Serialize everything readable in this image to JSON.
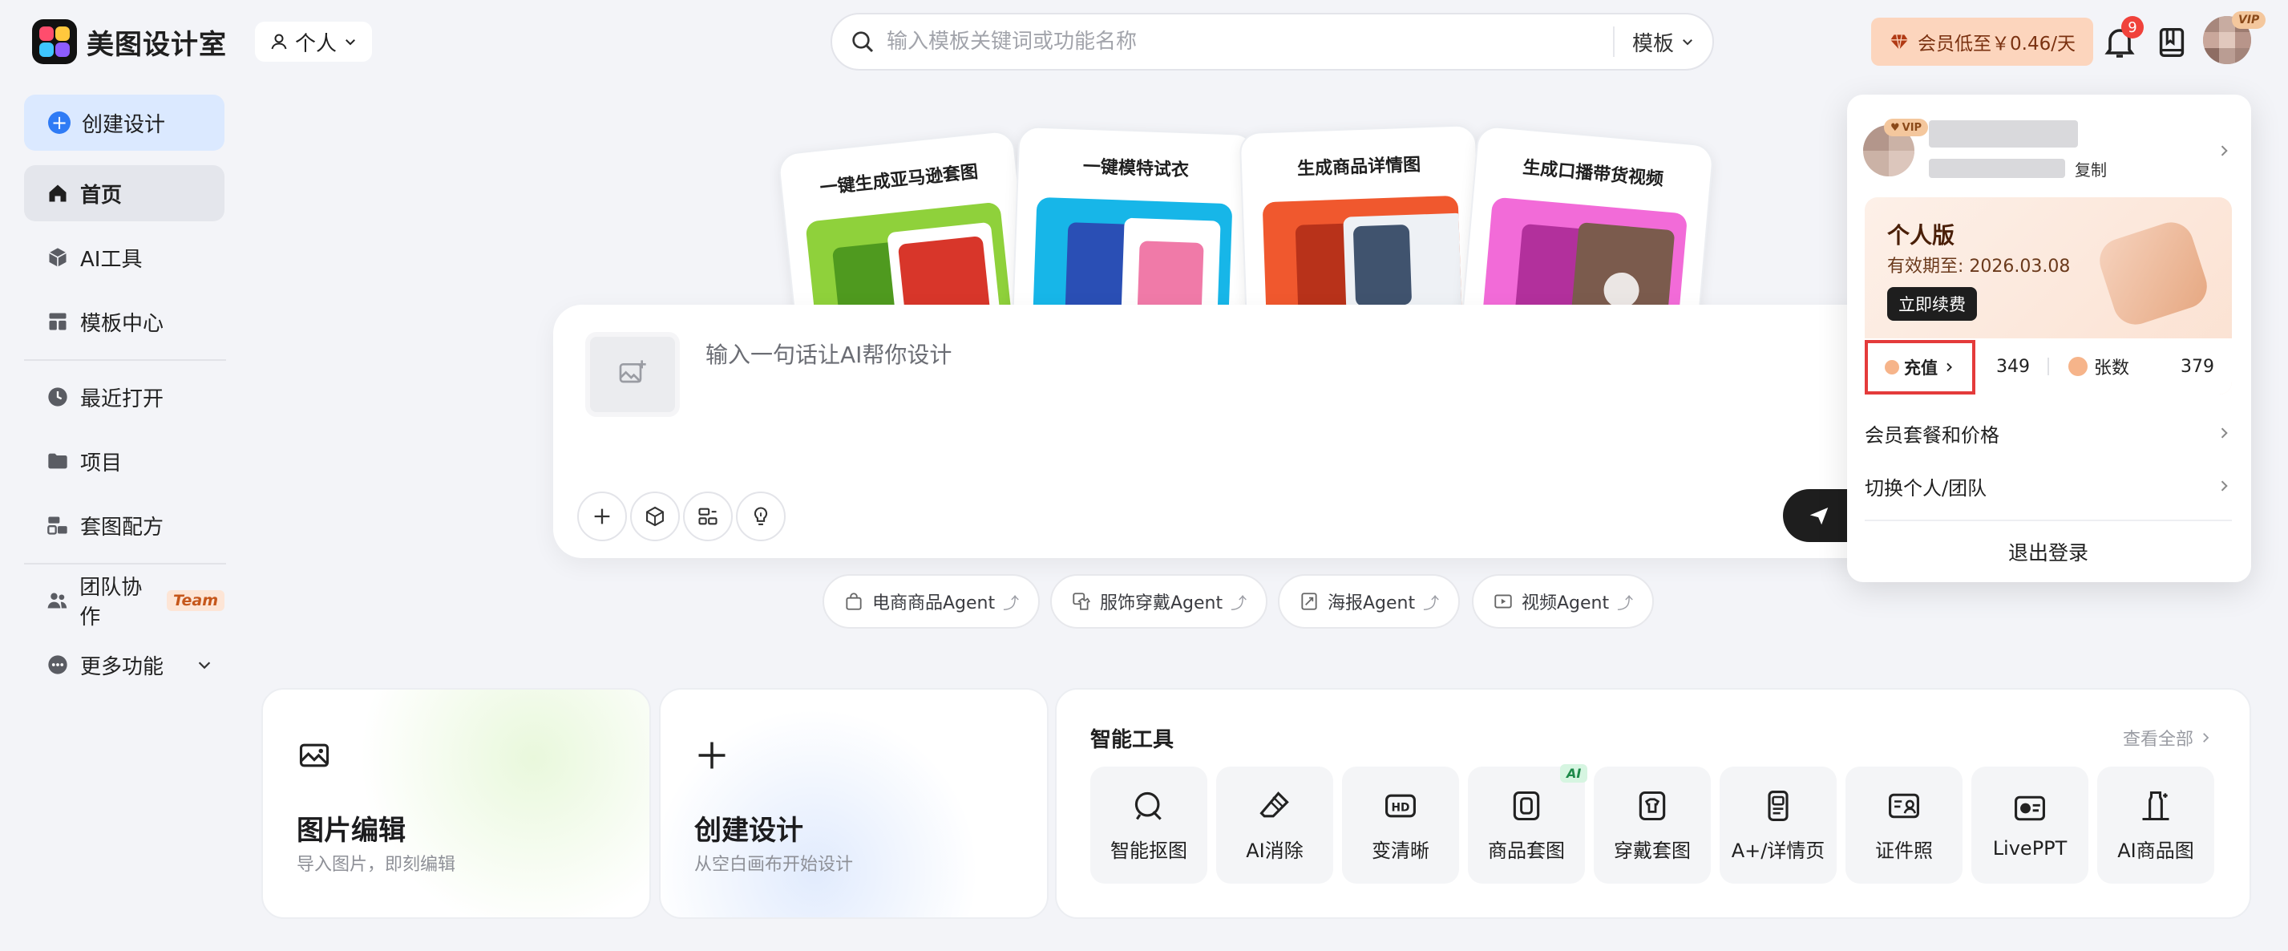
{
  "app": {
    "name": "美图设计室"
  },
  "header": {
    "mode_label": "个人",
    "search_placeholder": "输入模板关键词或功能名称",
    "search_type": "模板",
    "vip_promo": "会员低至￥0.46/天",
    "notification_count": "9",
    "avatar_badge": "VIP"
  },
  "sidebar": {
    "create_label": "创建设计",
    "items": [
      {
        "label": "首页"
      },
      {
        "label": "AI工具"
      },
      {
        "label": "模板中心"
      },
      {
        "label": "最近打开"
      },
      {
        "label": "项目"
      },
      {
        "label": "套图配方"
      },
      {
        "label": "团队协作",
        "tag": "Team"
      },
      {
        "label": "更多功能"
      }
    ]
  },
  "template_cards": [
    {
      "title": "一键生成亚马逊套图"
    },
    {
      "title": "一键模特试衣"
    },
    {
      "title": "生成商品详情图"
    },
    {
      "title": "生成口播带货视频"
    }
  ],
  "ai_box": {
    "placeholder": "输入一句话让AI帮你设计"
  },
  "agents": [
    {
      "label": "电商商品Agent"
    },
    {
      "label": "服饰穿戴Agent"
    },
    {
      "label": "海报Agent"
    },
    {
      "label": "视频Agent"
    }
  ],
  "bottom_cards": [
    {
      "title": "图片编辑",
      "subtitle": "导入图片，即刻编辑"
    },
    {
      "title": "创建设计",
      "subtitle": "从空白画布开始设计"
    }
  ],
  "tools": {
    "title": "智能工具",
    "view_all": "查看全部",
    "ai_badge": "AI",
    "items": [
      {
        "label": "智能抠图",
        "icon": "smart-cutout-icon"
      },
      {
        "label": "AI消除",
        "icon": "eraser-icon"
      },
      {
        "label": "变清晰",
        "icon": "hd-icon"
      },
      {
        "label": "商品套图",
        "icon": "product-set-icon"
      },
      {
        "label": "穿戴套图",
        "icon": "apparel-set-icon"
      },
      {
        "label": "A+/详情页",
        "icon": "detail-page-icon"
      },
      {
        "label": "证件照",
        "icon": "id-photo-icon"
      },
      {
        "label": "LivePPT",
        "icon": "ppt-icon"
      },
      {
        "label": "AI商品图",
        "icon": "product-photo-icon"
      }
    ]
  },
  "dropdown": {
    "vip_badge": "VIP",
    "copy_label": "复制",
    "plan_name": "个人版",
    "plan_expiry": "有效期至: 2026.03.08",
    "renew_label": "立即续费",
    "recharge_label": "充值",
    "beans": "349",
    "sheets_label": "张数",
    "sheets": "379",
    "menu": [
      {
        "label": "会员套餐和价格"
      },
      {
        "label": "切换个人/团队"
      }
    ],
    "logout_label": "退出登录"
  },
  "colors": {
    "accent": "#2f7bf5",
    "danger": "#e43b3b",
    "vip_bg": "#fcd5bd"
  }
}
